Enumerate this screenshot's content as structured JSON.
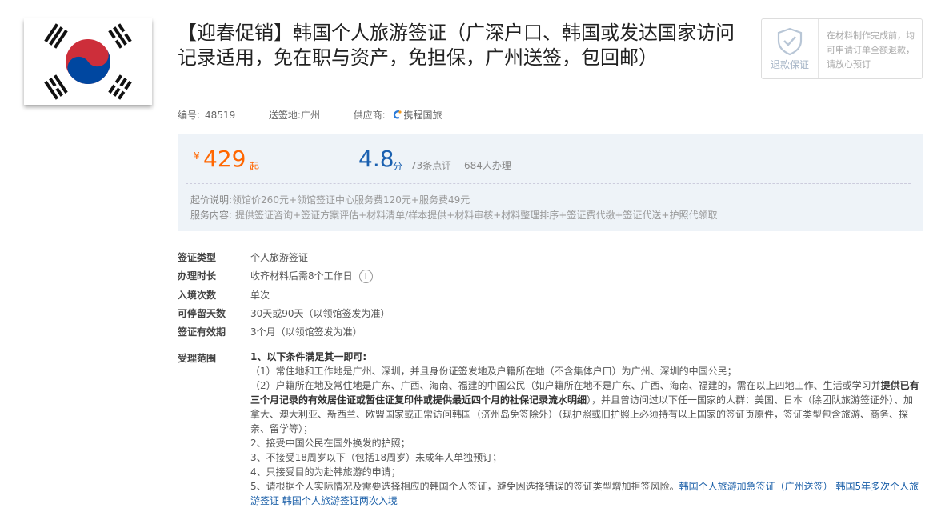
{
  "product": {
    "title": "【迎春促销】韩国个人旅游签证（广深户口、韩国或发达国家访问记录适用，免在职与资产，免担保，广州送签，包回邮）"
  },
  "guarantee": {
    "label": "退款保证",
    "text": "在材料制作完成前，均可申请订单全额退款，请放心预订"
  },
  "meta": {
    "id_label": "编号:",
    "id_value": "48519",
    "location_label": "送签地:",
    "location_value": "广州",
    "supplier_label": "供应商:",
    "supplier_value": "携程国旅"
  },
  "price": {
    "currency": "¥",
    "value": "429",
    "unit": "起",
    "score": "4.8",
    "score_unit": "分",
    "reviews": "73条点评",
    "handled": "684人办理",
    "price_note_label": "起价说明:",
    "price_note": "领馆价260元+领馆签证中心服务费120元+服务费49元",
    "service_label": "服务内容:",
    "service": "提供签证咨询+签证方案评估+材料清单/样本提供+材料审核+材料整理排序+签证费代缴+签证代送+护照代领取"
  },
  "attributes": [
    {
      "label": "签证类型",
      "value": "个人旅游签证"
    },
    {
      "label": "办理时长",
      "value": "收齐材料后需8个工作日"
    },
    {
      "label": "入境次数",
      "value": "单次"
    },
    {
      "label": "可停留天数",
      "value": "30天或90天（以领馆签发为准）"
    },
    {
      "label": "签证有效期",
      "value": "3个月（以领馆签发为准）"
    }
  ],
  "scope": {
    "label": "受理范围",
    "l1": "1、以下条件满足其一即可:",
    "l2": "（1）常住地和工作地是广州、深圳，并且身份证签发地及户籍所在地（不含集体户口）为广州、深圳的中国公民；",
    "l3a": "（2）户籍所在地及常住地是广东、广西、海南、福建的中国公民（如户籍所在地不是广东、广西、海南、福建的，需在以上四地工作、生活或学习并",
    "l3b": "提供已有三个月记录的有效居住证或暂住证复印件或提供最近四个月的社保记录流水明细",
    "l3c": "），并且曾访问过以下任一国家的人群：美国、日本（除团队旅游签证外）、加拿大、澳大利亚、新西兰、欧盟国家或正常访问韩国（济州岛免签除外）（现护照或旧护照上必须持有以上国家的签证页原件，签证类型包含旅游、商务、探亲、留学等）；",
    "l4": "2、接受中国公民在国外换发的护照；",
    "l5": "3、不接受18周岁以下（包括18周岁）未成年人单独预订；",
    "l6": "4、只接受目的为赴韩旅游的申请；",
    "l7": "5、请根据个人实际情况及需要选择相应的韩国个人签证，避免因选择错误的签证类型增加拒签风险。",
    "link1": "韩国个人旅游加急签证（广州送签）",
    "link2": "韩国5年多次个人旅游签证",
    "link3": "韩国个人旅游签证两次入境"
  }
}
